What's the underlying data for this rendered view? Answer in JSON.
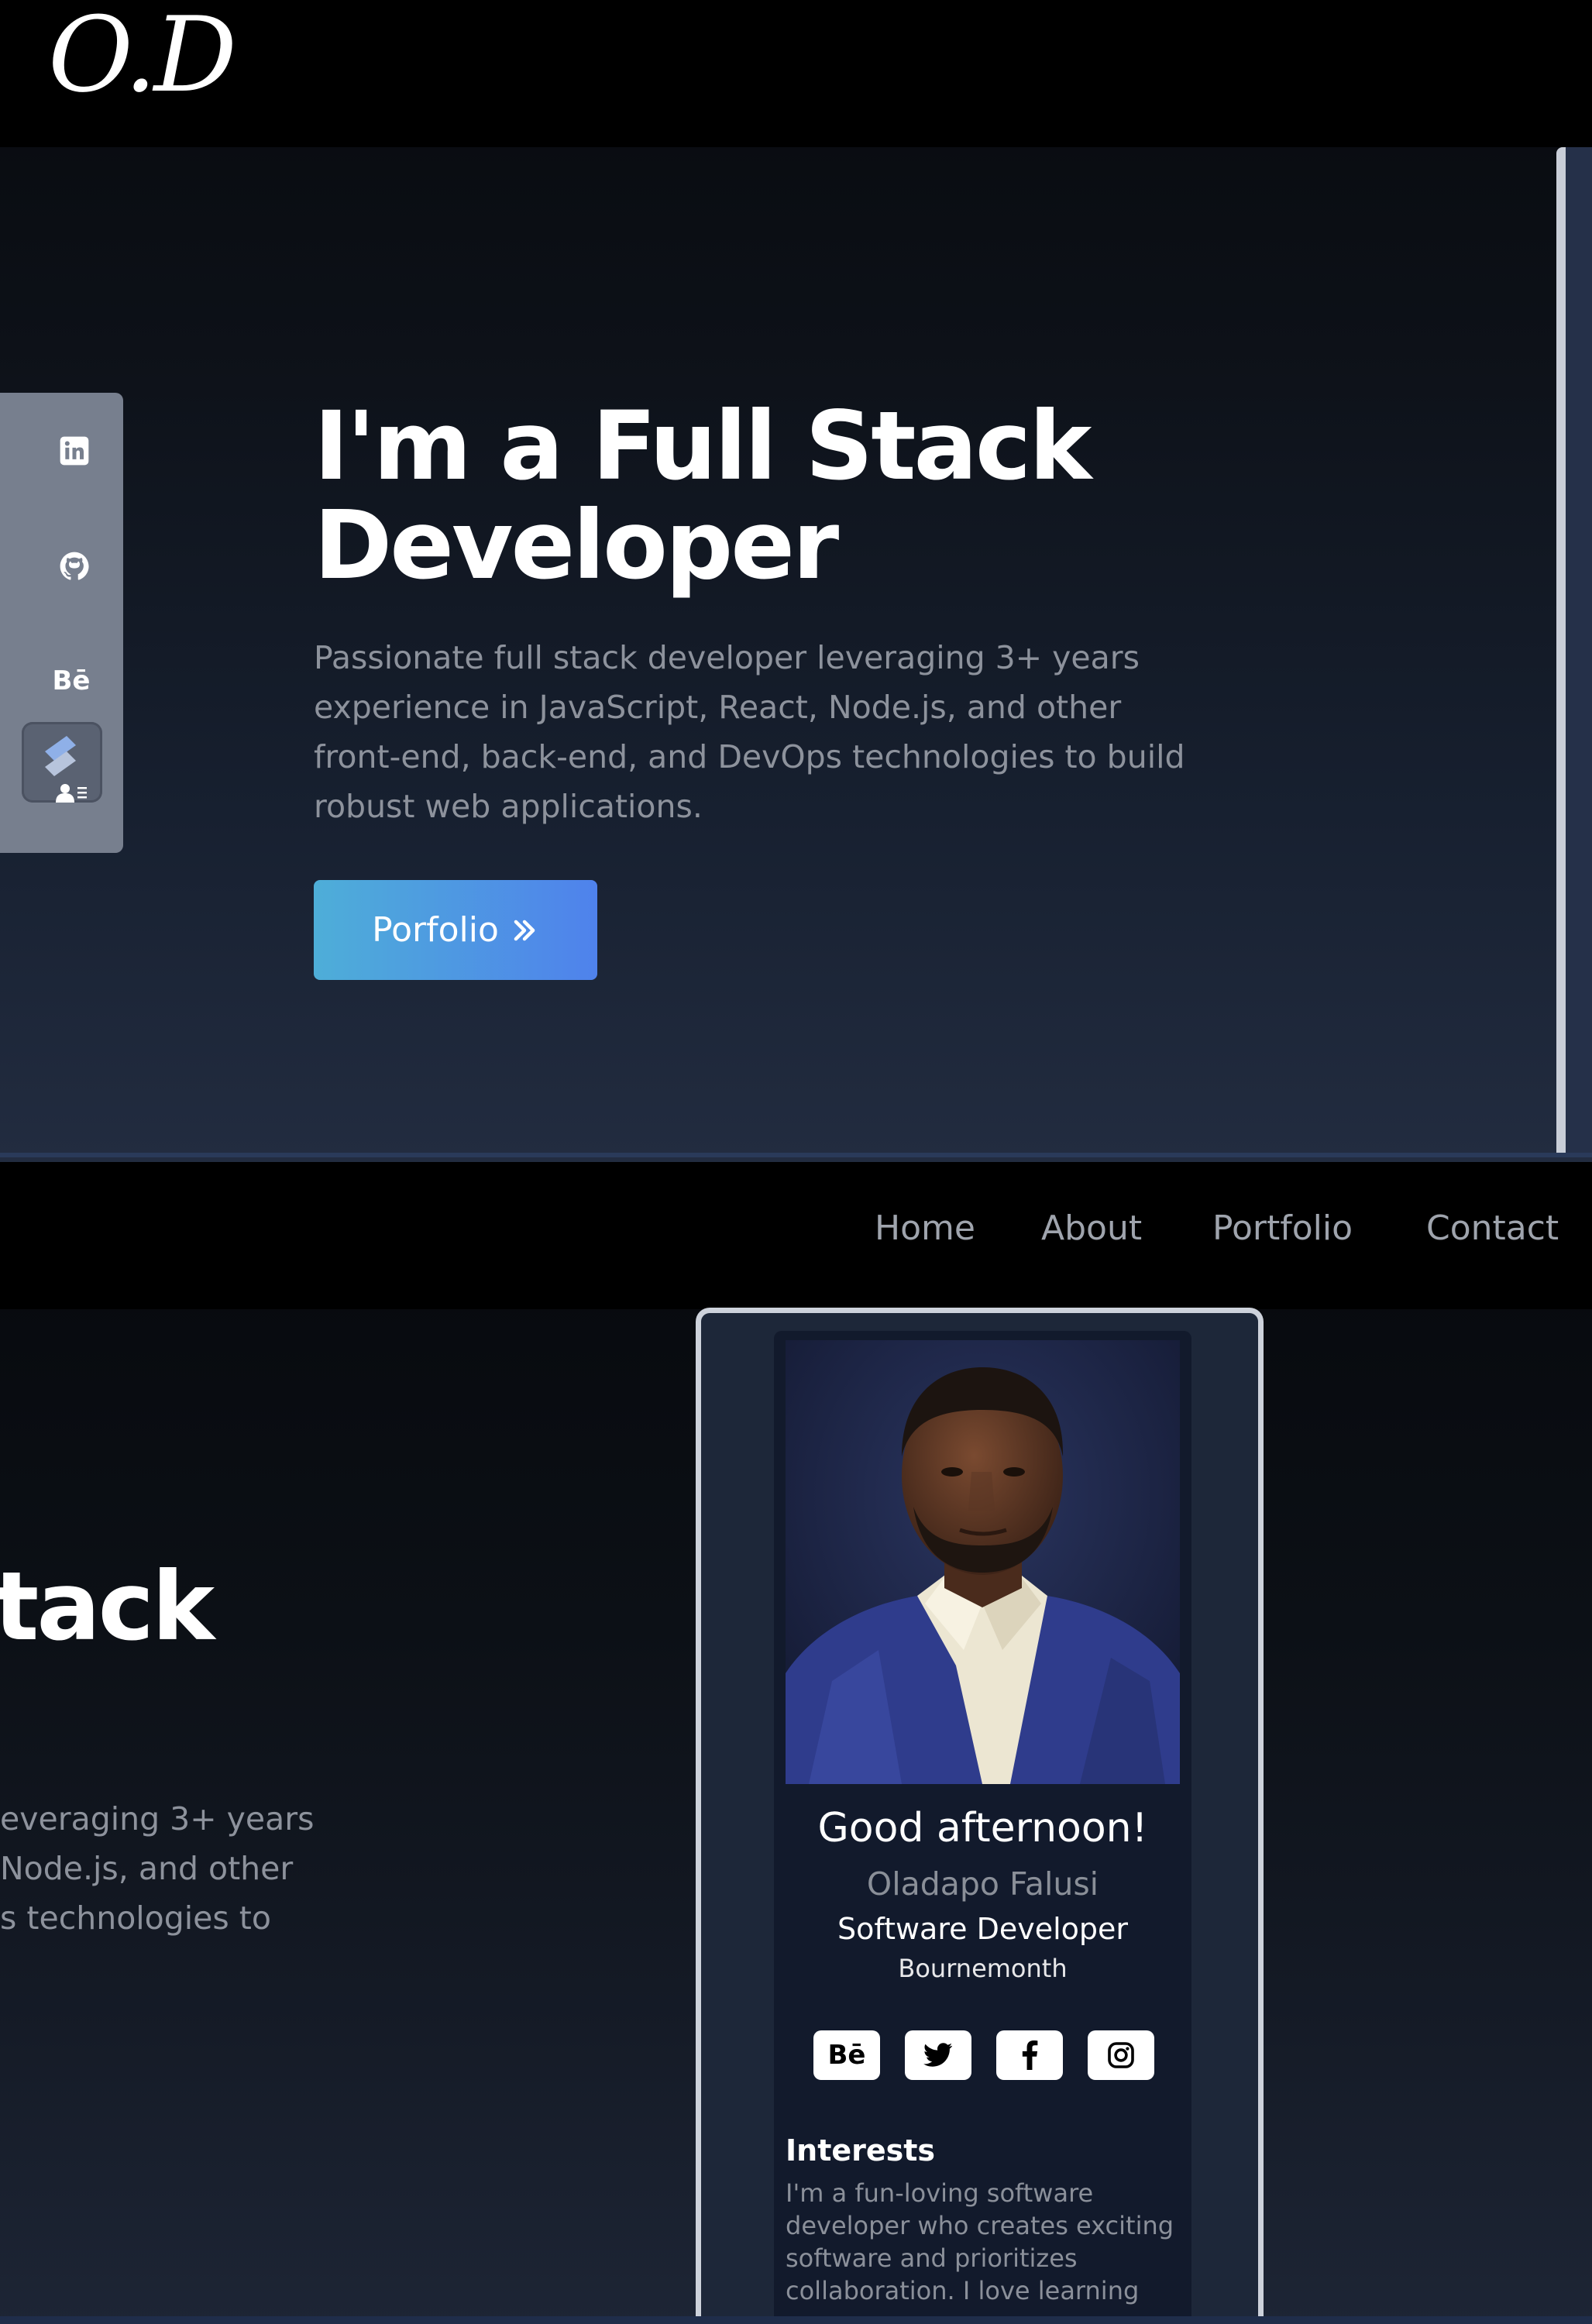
{
  "brand": {
    "logo_text": "O.D"
  },
  "social_rail": {
    "items": [
      "linkedin-icon",
      "github-icon",
      "behance-icon",
      "resume-icon"
    ],
    "behance_label": "Bē"
  },
  "hero": {
    "title_line1": "I'm a Full Stack",
    "title_line2": "Developer",
    "description": "Passionate full stack developer leveraging 3+ years experience in JavaScript, React, Node.js, and other front-end, back-end, and DevOps technologies to build robust web applications.",
    "cta_label": "Porfolio"
  },
  "nav": {
    "items": [
      "Home",
      "About",
      "Portfolio",
      "Contact"
    ]
  },
  "hero_cropped": {
    "title_fragment": "tack",
    "lines": [
      "everaging 3+ years",
      "Node.js, and other",
      "s technologies to"
    ]
  },
  "profile_card": {
    "greeting": "Good afternoon!",
    "name": "Oladapo Falusi",
    "role": "Software Developer",
    "location": "Bournemonth",
    "socials": [
      "behance-icon",
      "twitter-icon",
      "facebook-icon",
      "instagram-icon"
    ],
    "behance_label": "Bē",
    "interests_title": "Interests",
    "interests_text": "I'm a fun-loving software developer who creates exciting software and prioritizes collaboration. I love learning"
  },
  "colors": {
    "button_gradient_start": "#4eaed8",
    "button_gradient_end": "#4f82ec",
    "muted_text": "#8d929c",
    "rail_bg": "#777f8e"
  }
}
